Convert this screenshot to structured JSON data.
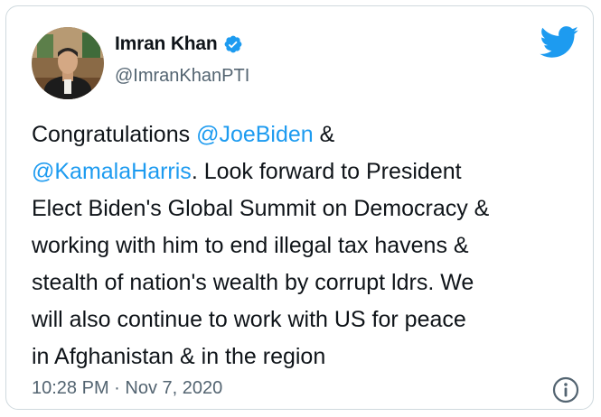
{
  "user": {
    "display_name": "Imran Khan",
    "handle": "@ImranKhanPTI",
    "verified": true
  },
  "tweet": {
    "lines": [
      [
        {
          "text": "Congratulations ",
          "type": "text"
        },
        {
          "text": "@JoeBiden",
          "type": "mention"
        },
        {
          "text": " &",
          "type": "text"
        }
      ],
      [
        {
          "text": "@KamalaHarris",
          "type": "mention"
        },
        {
          "text": ". Look forward to President",
          "type": "text"
        }
      ],
      [
        {
          "text": "Elect Biden's Global Summit on Democracy &",
          "type": "text"
        }
      ],
      [
        {
          "text": "working with him to end illegal tax havens &",
          "type": "text"
        }
      ],
      [
        {
          "text": "stealth of nation's wealth by corrupt ldrs. We",
          "type": "text"
        }
      ],
      [
        {
          "text": "will also continue to work with US for peace",
          "type": "text"
        }
      ],
      [
        {
          "text": "in Afghanistan & in the region",
          "type": "text"
        }
      ]
    ]
  },
  "footer": {
    "timestamp": "10:28 PM · Nov 7, 2020"
  },
  "icons": {
    "brand": "twitter-bird-icon",
    "verified": "verified-badge-icon",
    "info": "info-icon"
  },
  "colors": {
    "accent": "#1d9bf0",
    "text": "#0f1419",
    "muted": "#536471",
    "border": "#cfd9de"
  }
}
